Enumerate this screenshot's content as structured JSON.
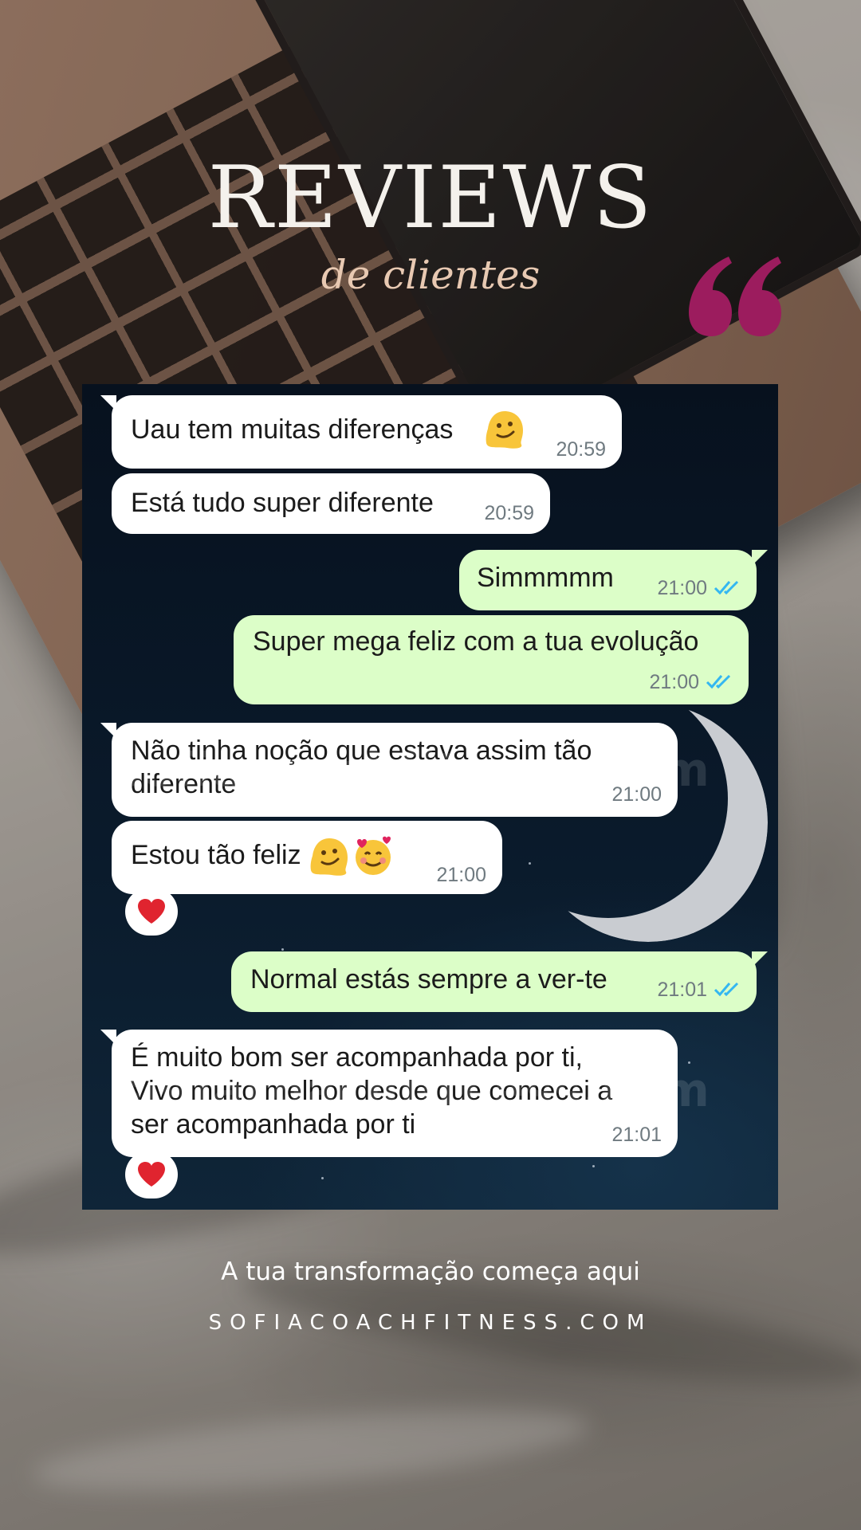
{
  "header": {
    "title": "REVIEWS",
    "subtitle": "de clientes"
  },
  "quote_icon": {
    "name": "quotation-mark-icon",
    "color": "#9c1c5e"
  },
  "chat": {
    "watermark": "sofiacoachfitness.com",
    "messages": [
      {
        "dir": "in",
        "lines": [
          "Uau tem muitas diferenças"
        ],
        "emoji": "melting-face",
        "time": "20:59"
      },
      {
        "dir": "in",
        "lines": [
          "Está tudo super diferente"
        ],
        "time": "20:59"
      },
      {
        "dir": "out",
        "lines": [
          "Simmmmm"
        ],
        "time": "21:00",
        "status": "read"
      },
      {
        "dir": "out",
        "lines": [
          "Super mega feliz com a tua evolução"
        ],
        "time": "21:00",
        "status": "read"
      },
      {
        "dir": "in",
        "lines": [
          "Não tinha noção que estava assim tão",
          "diferente"
        ],
        "time": "21:00"
      },
      {
        "dir": "in",
        "lines": [
          "Estou tão feliz"
        ],
        "emoji": "melting-face, smiling-face-with-hearts",
        "time": "21:00",
        "reaction": "red-heart"
      },
      {
        "dir": "out",
        "lines": [
          "Normal estás sempre a ver-te"
        ],
        "time": "21:01",
        "status": "read"
      },
      {
        "dir": "in",
        "lines": [
          "É muito bom ser acompanhada por ti,",
          "Vivo muito melhor desde que comecei a",
          "ser acompanhada por ti"
        ],
        "time": "21:01",
        "reaction": "red-heart"
      }
    ],
    "colors": {
      "incoming": "#ffffff",
      "outgoing": "#dcfec8",
      "read_ticks": "#34b7f1"
    }
  },
  "footer": {
    "tagline": "A tua transformação começa aqui",
    "website": "SOFIACOACHFITNESS.COM"
  }
}
